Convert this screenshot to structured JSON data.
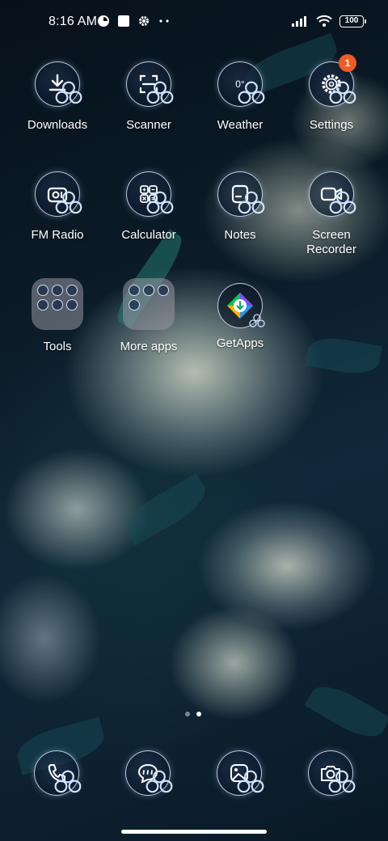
{
  "status_bar": {
    "time": "8:16 AM",
    "battery": "100",
    "icons": [
      "app-notification-icon",
      "square-notification-icon",
      "gear-icon",
      "more-dots-icon",
      "signal-icon",
      "wifi-icon",
      "battery-icon"
    ]
  },
  "apps": {
    "downloads": {
      "label": "Downloads"
    },
    "scanner": {
      "label": "Scanner"
    },
    "weather": {
      "label": "Weather",
      "temp": "0°"
    },
    "settings": {
      "label": "Settings",
      "badge": "1"
    },
    "fm_radio": {
      "label": "FM Radio"
    },
    "calculator": {
      "label": "Calculator"
    },
    "notes": {
      "label": "Notes"
    },
    "screen_recorder": {
      "label": "Screen Recorder"
    },
    "tools": {
      "label": "Tools"
    },
    "more_apps": {
      "label": "More apps"
    },
    "getapps": {
      "label": "GetApps"
    }
  },
  "dock": [
    "phone-icon",
    "messages-icon",
    "gallery-icon",
    "camera-icon"
  ],
  "pagination": {
    "pages": 2,
    "current": 2
  },
  "colors": {
    "badge": "#f05a24",
    "icon_ring": "#dcebff",
    "wallpaper_bg": "#0b1c28"
  }
}
